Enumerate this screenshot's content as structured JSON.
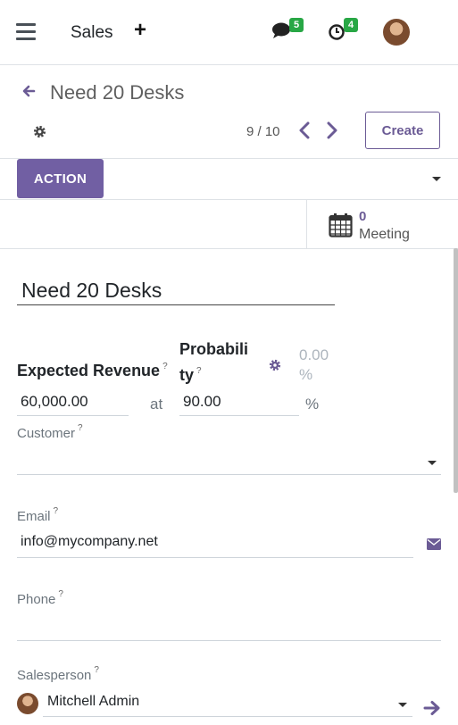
{
  "navbar": {
    "app_name": "Sales",
    "messages_count": "5",
    "activities_count": "4"
  },
  "breadcrumb": {
    "record_title": "Need 20 Desks"
  },
  "pager": {
    "value": "9 / 10"
  },
  "buttons": {
    "create": "Create",
    "action": "ACTION"
  },
  "smart_button": {
    "count": "0",
    "label": "Meeting"
  },
  "form": {
    "name": "Need 20 Desks",
    "expected_revenue_label": "Expected Revenue",
    "expected_revenue_value": "60,000.00",
    "at_label": "at",
    "probability_label_line1": "Probabili",
    "probability_label_line2": "ty",
    "probability_value": "90.00",
    "automated_probability": "0.00",
    "percent_sign": "%",
    "help_mark": "?",
    "customer_label": "Customer",
    "customer_value": "",
    "email_label": "Email",
    "email_value": "info@mycompany.net",
    "phone_label": "Phone",
    "phone_value": "",
    "salesperson_label": "Salesperson",
    "salesperson_value": "Mitchell Admin"
  },
  "colors": {
    "accent": "#715fa3",
    "badge": "#28a745"
  }
}
